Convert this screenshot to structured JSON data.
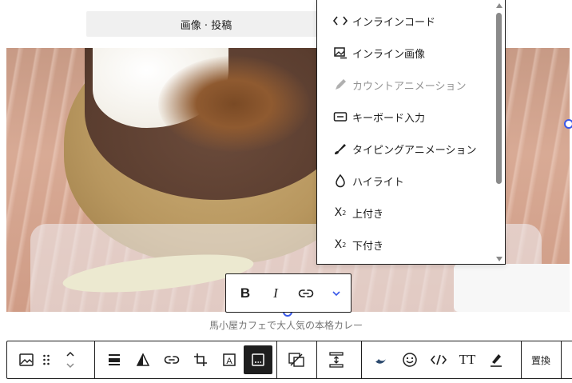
{
  "header": {
    "title": "画像 · 投稿"
  },
  "figure": {
    "caption": "馬小屋カフェで大人気の本格カレー"
  },
  "dropdown": {
    "items": [
      {
        "label": "インラインコード",
        "icon": "code-icon",
        "disabled": false
      },
      {
        "label": "インライン画像",
        "icon": "inline-image-icon",
        "disabled": false
      },
      {
        "label": "カウントアニメーション",
        "icon": "pencil-icon",
        "disabled": true
      },
      {
        "label": "キーボード入力",
        "icon": "keyboard-icon",
        "disabled": false
      },
      {
        "label": "タイピングアニメーション",
        "icon": "brush-icon",
        "disabled": false
      },
      {
        "label": "ハイライト",
        "icon": "droplet-icon",
        "disabled": false
      },
      {
        "label": "上付き",
        "icon": "superscript-icon",
        "disabled": false
      },
      {
        "label": "下付き",
        "icon": "subscript-icon",
        "disabled": false
      }
    ]
  },
  "inline_toolbar": {
    "bold": "B",
    "italic": "I"
  },
  "block_toolbar": {
    "replace_label": "置換",
    "text_size_label": "TT"
  },
  "colors": {
    "accent": "#3858e9",
    "text": "#1e1e1e",
    "muted": "#757575"
  }
}
